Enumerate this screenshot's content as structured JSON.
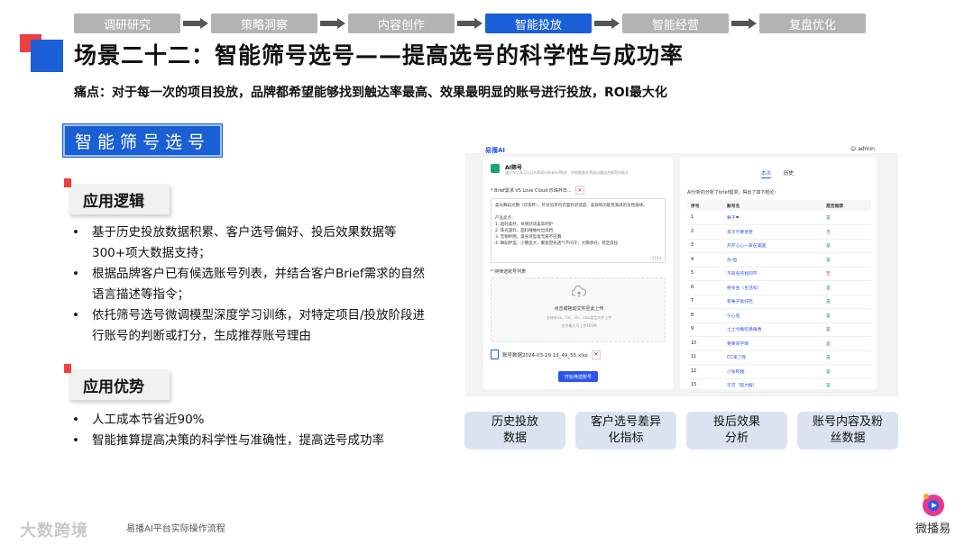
{
  "flow": {
    "steps": [
      "调研研究",
      "策略洞察",
      "内容创作",
      "智能投放",
      "智能经营",
      "复盘优化"
    ],
    "active_index": 3
  },
  "title": "场景二十二：智能筛号选号——提高选号的科学性与成功率",
  "pain_point": "痛点：对于每一次的项目投放，品牌都希望能够找到触达率最高、效果最明显的账号进行投放，ROI最大化",
  "badge": "智能筛号选号",
  "logic": {
    "heading": "应用逻辑",
    "items": [
      "基于历史投放数据积累、客户选号偏好、投后效果数据等300+项大数据支持；",
      "根据品牌客户已有候选账号列表，并结合客户Brief需求的自然语言描述等指令；",
      "依托筛号选号微调模型深度学习训练，对特定项目/投放阶段进行账号的判断或打分，生成推荐账号理由"
    ]
  },
  "advantage": {
    "heading": "应用优势",
    "items": [
      "人工成本节省近90%",
      "智能推算提高决策的科学性与准确性，提高选号成功率"
    ]
  },
  "app": {
    "logo": "易播AI",
    "user": "admin",
    "left": {
      "title": "AI筛号",
      "desc": "通过AI工具可以让AI帮助分析brief需求，并根据需求筛选出最适合推荐的账号",
      "brief_label": "* Brief需求  VS Love Cloud 珍珠杯日...",
      "brief_lines": [
        "柔光舞蹈文胸（珍珠杯），针对追求内衣面料舒适度、美观和功能性兼具的女性群体。",
        "",
        "产品卖点：",
        "1. 超轻柔杯，体感舒适柔软呵护",
        "2. 珠光面料，面料睡抽衬出高档",
        "3. 无钢杯圈，紧身弯型着无痕不压胸",
        "4. 舞蹈杯型，小胸变大，聚拢塑形透气不闷汗；大胸承托，稳定提拉"
      ],
      "brief_count": "1154",
      "upload_label": "* 待筛选账号列表",
      "upload_main": "点击或拖动文件至此上传",
      "upload_types": "支持docx、txt、xls、xlsx类型文件上传",
      "upload_limit": "文件最大可上传100M",
      "file_name": "账号数据2024-03-29 13_49_55.xlsx",
      "start_button": "开始筛选账号"
    },
    "right": {
      "tabs": [
        "本次",
        "历史"
      ],
      "lead": "AI分析的分析了brief需求，得出了如下结论：",
      "columns": [
        "序号",
        "账号名",
        "是否推荐"
      ],
      "rows": [
        [
          "1",
          "栗子❤",
          "是",
          true
        ],
        [
          "2",
          "孩子不要善茬",
          "否",
          false
        ],
        [
          "3",
          "芹芹心心一家在美国",
          "是",
          true
        ],
        [
          "4",
          "孙·恒",
          "是",
          true
        ],
        [
          "5",
          "不知名的程同学",
          "否",
          false
        ],
        [
          "6",
          "桥多金（生活号）",
          "是",
          true
        ],
        [
          "7",
          "有栗子真好吃",
          "是",
          true
        ],
        [
          "8",
          "宁心宛",
          "是",
          true
        ],
        [
          "9",
          "土土今晚吃串串香",
          "是",
          true
        ],
        [
          "10",
          "莱莱同学啊",
          "是",
          true
        ],
        [
          "11",
          "CC来了呢",
          "是",
          true
        ],
        [
          "12",
          "小张阿姨.",
          "是",
          true
        ],
        [
          "13",
          "可可（努力版）",
          "是",
          true
        ]
      ]
    }
  },
  "features": [
    "历史投放\n数据",
    "客户选号差异\n化指标",
    "投后效果\n分析",
    "账号内容及粉\n丝数据"
  ],
  "footer": {
    "source": "易播AI平台实际操作流程",
    "watermark": "大数跨境",
    "brand": "微播易"
  },
  "colors": {
    "accent": "#1a5fd6",
    "red": "#ee4040",
    "inactive_step": "#b3b3b3",
    "feature_bg": "#dbe3f1",
    "app_link": "#2b55e6",
    "yes": "#1aa36f",
    "no": "#e04040"
  }
}
